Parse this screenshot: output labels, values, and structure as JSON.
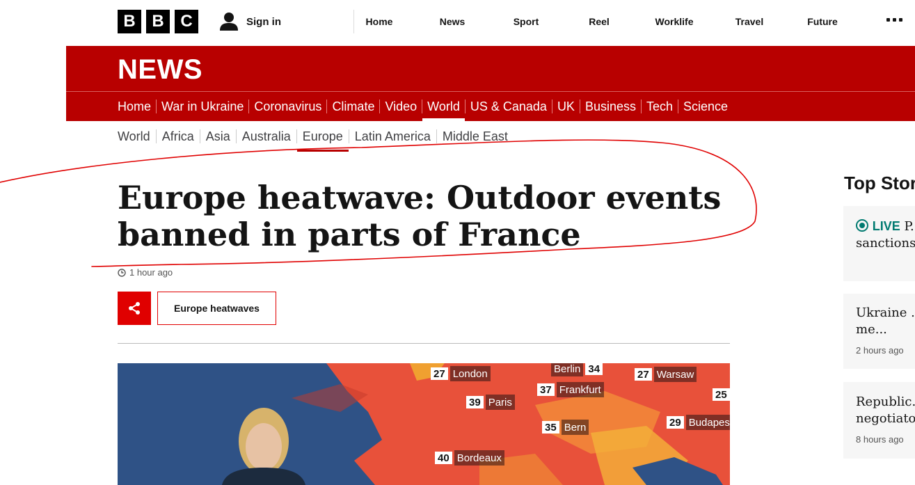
{
  "bbc_logo": [
    "B",
    "B",
    "C"
  ],
  "top": {
    "sign_in": "Sign in",
    "nav": [
      "Home",
      "News",
      "Sport",
      "Reel",
      "Worklife",
      "Travel",
      "Future"
    ]
  },
  "news": {
    "title": "NEWS",
    "nav": [
      "Home",
      "War in Ukraine",
      "Coronavirus",
      "Climate",
      "Video",
      "World",
      "US & Canada",
      "UK",
      "Business",
      "Tech",
      "Science"
    ],
    "active": "World"
  },
  "sub_nav": {
    "items": [
      "World",
      "Africa",
      "Asia",
      "Australia",
      "Europe",
      "Latin America",
      "Middle East"
    ],
    "active": "Europe"
  },
  "article": {
    "headline": "Europe heatwave: Outdoor events banned in parts of France",
    "timestamp": "1 hour ago",
    "topic": "Europe heatwaves"
  },
  "map": {
    "labels": [
      {
        "temp": "27",
        "city": "London"
      },
      {
        "temp": "",
        "city": "Berlin"
      },
      {
        "temp": "34",
        "city": ""
      },
      {
        "temp": "27",
        "city": "Warsaw"
      },
      {
        "temp": "37",
        "city": "Frankfurt"
      },
      {
        "temp": "39",
        "city": "Paris"
      },
      {
        "temp": "25",
        "city": ""
      },
      {
        "temp": "29",
        "city": "Budapest"
      },
      {
        "temp": "35",
        "city": "Bern"
      },
      {
        "temp": "40",
        "city": "Bordeaux"
      }
    ]
  },
  "sidebar": {
    "title": "Top Stories",
    "stories": [
      {
        "live": "LIVE",
        "title": "P... and thou... sanctions",
        "time": ""
      },
      {
        "live": "",
        "title": "Ukraine ... to EU me...",
        "time": "2 hours ago"
      },
      {
        "live": "",
        "title": "Republic... negotiato...",
        "time": "8 hours ago"
      }
    ]
  },
  "colors": {
    "news_red": "#b80000",
    "accent_red": "#e00000",
    "live_green": "#007a70",
    "annotation_red": "#e00000"
  }
}
